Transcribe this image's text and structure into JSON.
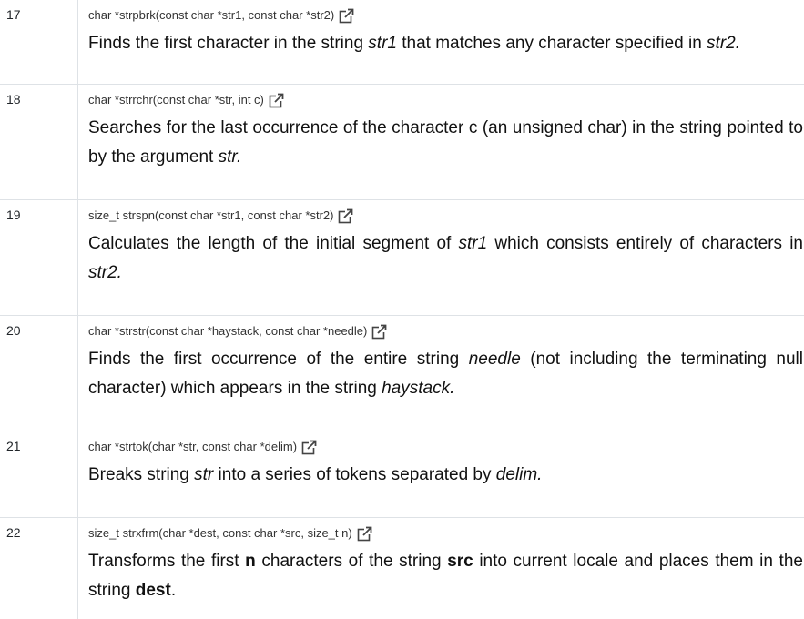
{
  "rows": [
    {
      "number": "17",
      "signature": "char *strpbrk(const char *str1, const char *str2)",
      "desc": [
        {
          "t": "Finds the first character in the string "
        },
        {
          "t": "str1",
          "i": true
        },
        {
          "t": " that matches any character specified in "
        },
        {
          "t": "str2.",
          "i": true
        }
      ]
    },
    {
      "number": "18",
      "signature": "char *strrchr(const char *str, int c)",
      "desc": [
        {
          "t": "Searches for the last occurrence of the character c (an unsigned char) in the string pointed to by the argument "
        },
        {
          "t": "str.",
          "i": true
        }
      ]
    },
    {
      "number": "19",
      "signature": "size_t strspn(const char *str1, const char *str2)",
      "desc": [
        {
          "t": "Calculates the length of the initial segment of "
        },
        {
          "t": "str1",
          "i": true
        },
        {
          "t": " which consists entirely of characters in "
        },
        {
          "t": "str2.",
          "i": true
        }
      ]
    },
    {
      "number": "20",
      "signature": "char *strstr(const char *haystack, const char *needle)",
      "desc": [
        {
          "t": "Finds the first occurrence of the entire string "
        },
        {
          "t": "needle",
          "i": true
        },
        {
          "t": " (not including the terminating null character) which appears in the string "
        },
        {
          "t": "haystack.",
          "i": true
        }
      ]
    },
    {
      "number": "21",
      "signature": "char *strtok(char *str, const char *delim)",
      "desc": [
        {
          "t": "Breaks string "
        },
        {
          "t": "str",
          "i": true
        },
        {
          "t": " into a series of tokens separated by "
        },
        {
          "t": "delim.",
          "i": true
        }
      ]
    },
    {
      "number": "22",
      "signature": "size_t strxfrm(char *dest, const char *src, size_t n)",
      "desc": [
        {
          "t": "Transforms the first "
        },
        {
          "t": "n",
          "b": true
        },
        {
          "t": " characters of the string "
        },
        {
          "t": "src",
          "b": true
        },
        {
          "t": " into current locale and places them in the string "
        },
        {
          "t": "dest",
          "b": true
        },
        {
          "t": "."
        }
      ]
    }
  ],
  "icons": {
    "external_link": "external-link-icon"
  }
}
